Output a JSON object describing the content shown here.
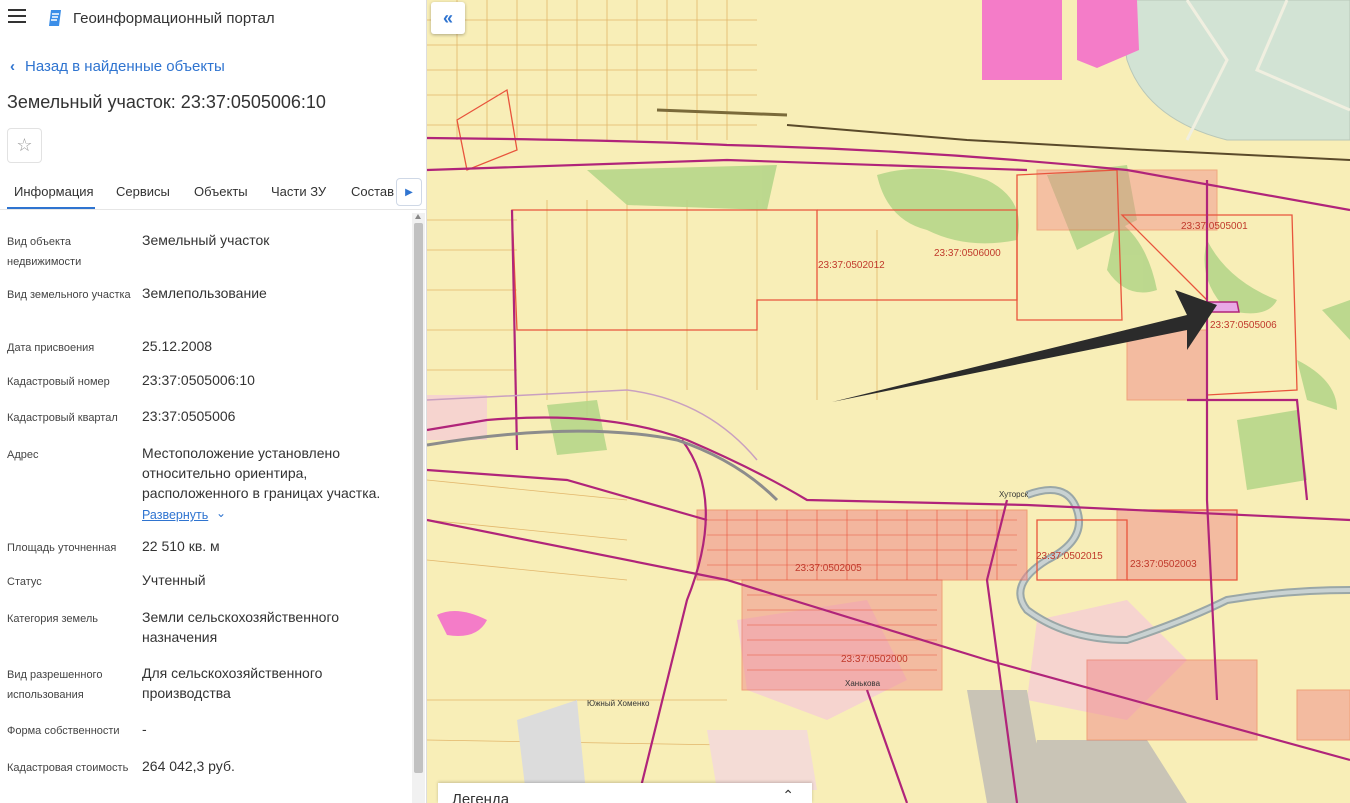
{
  "header": {
    "title": "Геоинформационный портал",
    "menu_icon": "hamburger-icon",
    "logo_icon": "portal-logo-icon"
  },
  "back_link": "Назад в найденные объекты",
  "object_title": "Земельный участок: 23:37:0505006:10",
  "favorite_icon": "star-icon",
  "tabs": [
    "Информация",
    "Сервисы",
    "Объекты",
    "Части ЗУ",
    "Состав"
  ],
  "attributes": [
    {
      "label": "Вид объекта недвижимости",
      "value": "Земельный участок"
    },
    {
      "label": "Вид земельного участка",
      "value": "Землепользование"
    },
    {
      "label": "Дата присвоения",
      "value": "25.12.2008"
    },
    {
      "label": "Кадастровый номер",
      "value": "23:37:0505006:10"
    },
    {
      "label": "Кадастровый квартал",
      "value": "23:37:0505006"
    },
    {
      "label": "Адрес",
      "value": "Местоположение установлено относительно ориентира, расположенного в границах участка."
    },
    {
      "label": "Площадь уточненная",
      "value": "22 510 кв. м"
    },
    {
      "label": "Статус",
      "value": "Учтенный"
    },
    {
      "label": "Категория земель",
      "value": "Земли сельскохозяйственного назначения"
    },
    {
      "label": "Вид разрешенного использования",
      "value": "Для сельскохозяйственного производства"
    },
    {
      "label": "Форма собственности",
      "value": "-"
    },
    {
      "label": "Кадастровая стоимость",
      "value": "264 042,3 руб."
    }
  ],
  "expand_link": "Развернуть",
  "map": {
    "labels": [
      "23:37:0505001",
      "23:37:0506000",
      "23:37:0502012",
      "23:37:0505006",
      "23:37:0502015",
      "23:37:0502003",
      "23:37:0502000",
      "23:37:0502005",
      "Южный Хоменко",
      "Ханькова",
      "Хуторск"
    ],
    "legend": "Легенда",
    "colors": {
      "background": "#f8eeb7",
      "parcel": "#e8543c",
      "boundary": "#b0247a",
      "river": "#9aa7a7",
      "green": "#b6d68a",
      "pink": "#f47cc8",
      "water": "#d8e6d8"
    }
  }
}
